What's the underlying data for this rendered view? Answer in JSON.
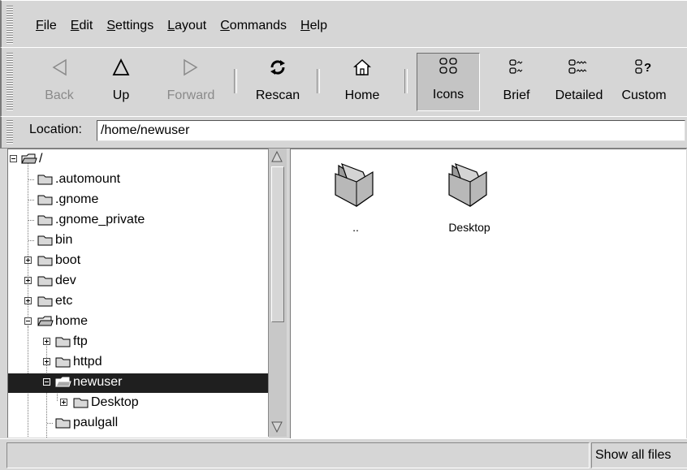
{
  "menubar": {
    "items": [
      {
        "label_ul": "F",
        "label_rest": "ile"
      },
      {
        "label_ul": "E",
        "label_rest": "dit"
      },
      {
        "label_ul": "S",
        "label_rest": "ettings"
      },
      {
        "label_ul": "L",
        "label_rest": "ayout"
      },
      {
        "label_ul": "C",
        "label_rest": "ommands"
      },
      {
        "label_ul": "H",
        "label_rest": "elp"
      }
    ]
  },
  "toolbar": {
    "back": "Back",
    "up": "Up",
    "forward": "Forward",
    "rescan": "Rescan",
    "home": "Home",
    "icons": "Icons",
    "brief": "Brief",
    "detailed": "Detailed",
    "custom": "Custom"
  },
  "location": {
    "label": "Location:",
    "value": "/home/newuser"
  },
  "tree": {
    "items": [
      "/",
      ".automount",
      ".gnome",
      ".gnome_private",
      "bin",
      "boot",
      "dev",
      "etc",
      "home",
      "ftp",
      "httpd",
      "newuser",
      "Desktop",
      "paulgall"
    ]
  },
  "files": [
    {
      "name": ".."
    },
    {
      "name": "Desktop"
    }
  ],
  "status": {
    "right": "Show all files"
  },
  "colors": {
    "chrome": "#d6d6d6",
    "selection": "#1f1f1f",
    "disabled_text": "#8a8a8a"
  }
}
